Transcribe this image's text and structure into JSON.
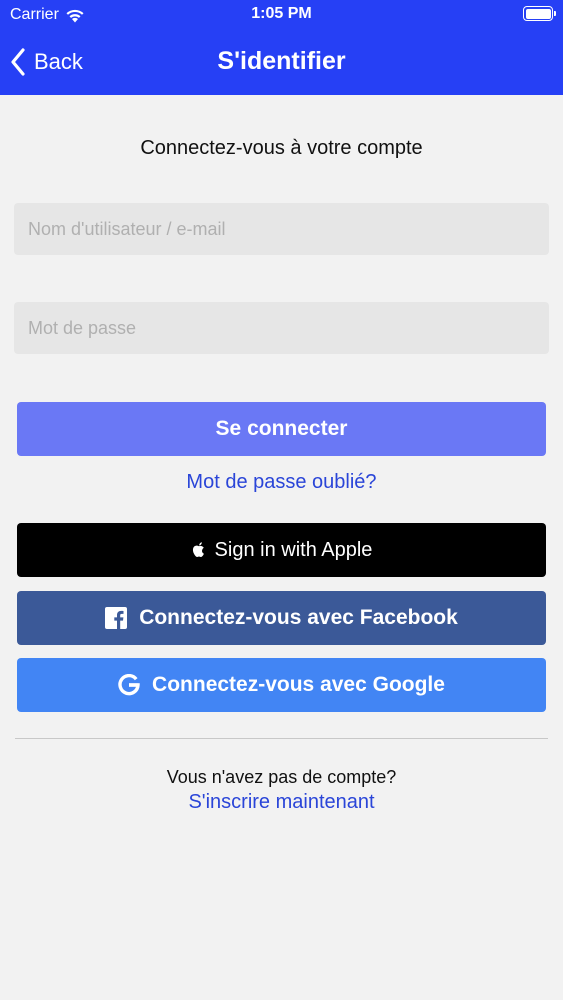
{
  "status_bar": {
    "carrier": "Carrier",
    "time": "1:05 PM",
    "icons": [
      "wifi-icon",
      "battery-icon"
    ]
  },
  "nav": {
    "back_label": "Back",
    "title": "S'identifier"
  },
  "form": {
    "subtitle": "Connectez-vous à votre compte",
    "username_placeholder": "Nom d'utilisateur / e-mail",
    "password_placeholder": "Mot de passe",
    "login_label": "Se connecter",
    "forgot_label": "Mot de passe oublié?"
  },
  "social": {
    "apple_label": "Sign in with Apple",
    "facebook_label": "Connectez-vous avec Facebook",
    "google_label": "Connectez-vous avec Google"
  },
  "signup": {
    "prompt": "Vous n'avez pas de compte?",
    "link_label": "S'inscrire maintenant"
  },
  "colors": {
    "header": "#2640f5",
    "login_button": "#6a78f5",
    "apple_button": "#000000",
    "facebook_button": "#3b5998",
    "google_button": "#4285f4",
    "link": "#2a45d8",
    "background": "#f2f2f2"
  }
}
